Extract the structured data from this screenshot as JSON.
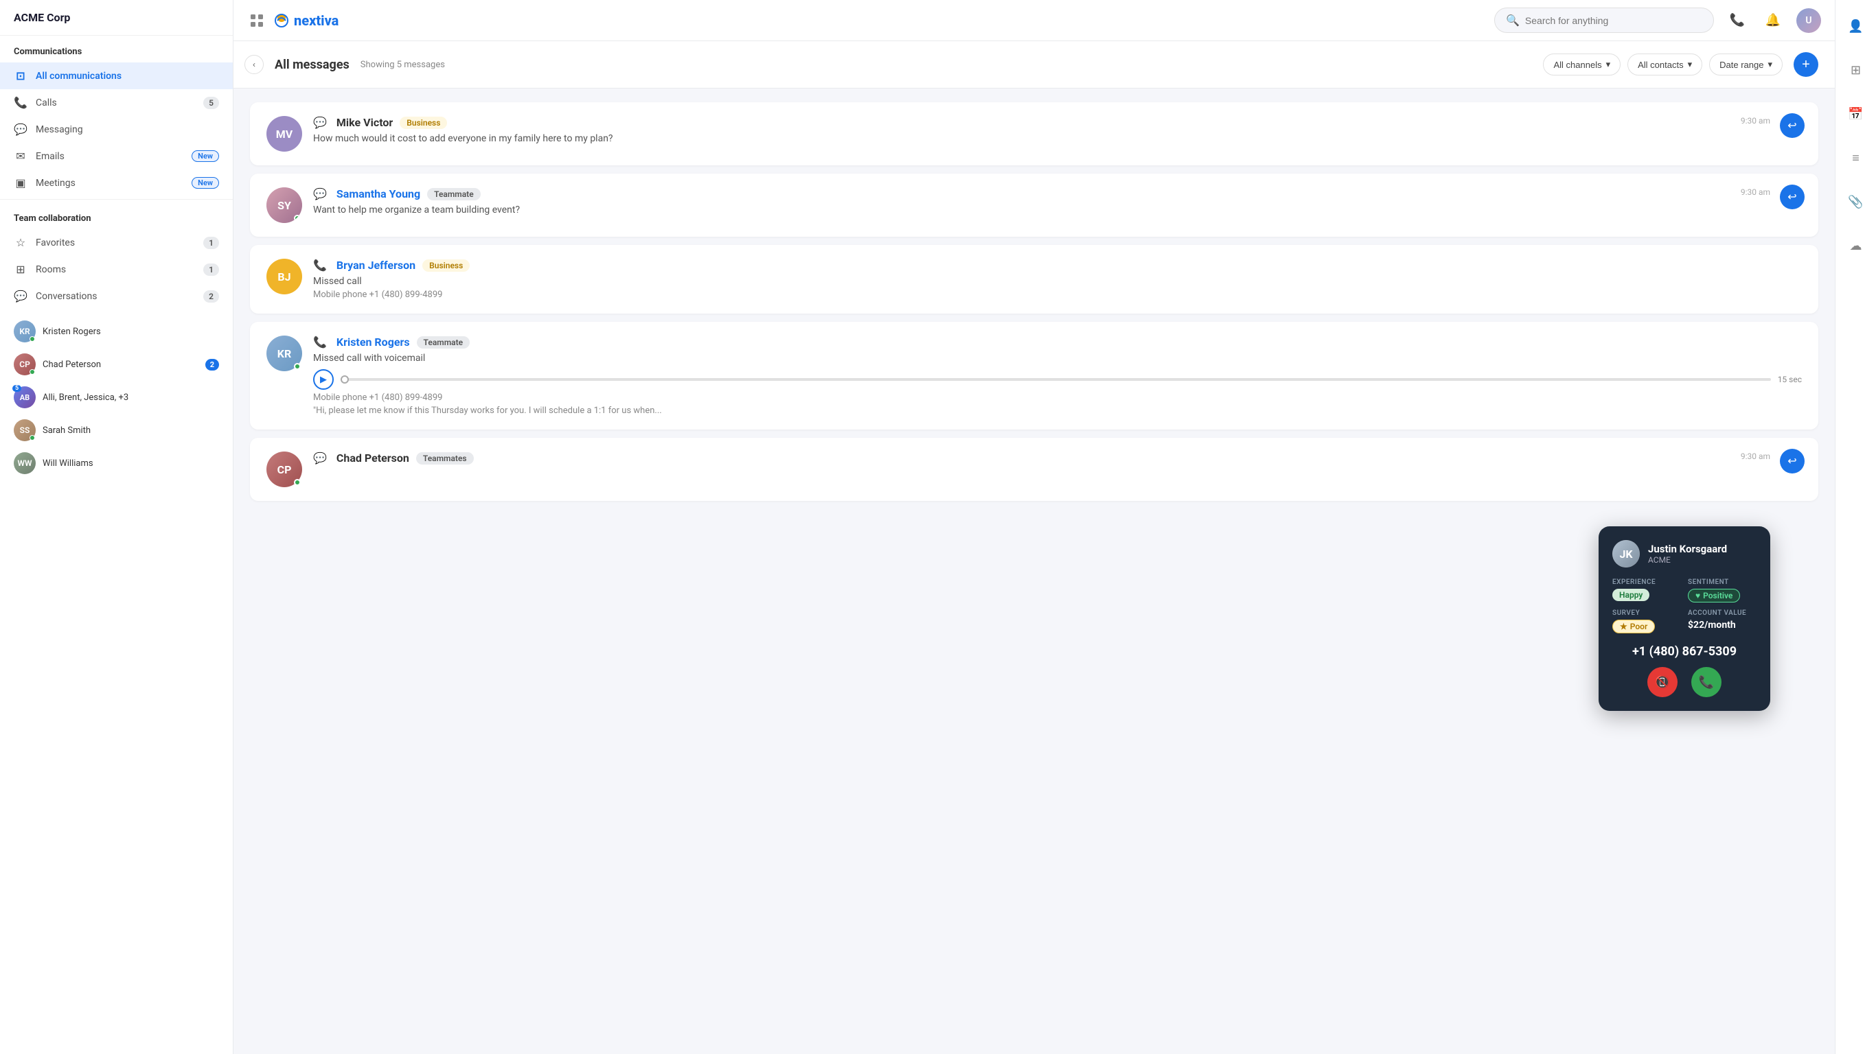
{
  "app": {
    "logo_text": "nextiva",
    "company": "ACME Corp"
  },
  "topnav": {
    "search_placeholder": "Search for anything"
  },
  "sidebar": {
    "header": "ACME Corp",
    "communications_section": "Communications",
    "nav_items": [
      {
        "id": "all-communications",
        "label": "All communications",
        "icon": "⊡",
        "badge": null,
        "active": true
      },
      {
        "id": "calls",
        "label": "Calls",
        "icon": "📞",
        "badge": "5",
        "active": false
      },
      {
        "id": "messaging",
        "label": "Messaging",
        "icon": "💬",
        "badge": null,
        "active": false
      },
      {
        "id": "emails",
        "label": "Emails",
        "icon": "✉️",
        "badge_new": "New",
        "active": false
      },
      {
        "id": "meetings",
        "label": "Meetings",
        "icon": "⬛",
        "badge_new": "New",
        "active": false
      }
    ],
    "team_collaboration": "Team collaboration",
    "team_items": [
      {
        "id": "favorites",
        "label": "Favorites",
        "icon": "☆",
        "badge": "1"
      },
      {
        "id": "rooms",
        "label": "Rooms",
        "icon": "⊞",
        "badge": "1"
      },
      {
        "id": "conversations",
        "label": "Conversations",
        "icon": "💬",
        "badge": "2"
      }
    ],
    "conversations_list": [
      {
        "id": "kristen-rogers",
        "name": "Kristen Rogers",
        "avatar_bg": "#a8c4e0",
        "initials": "KR",
        "online": true,
        "conv_badge": null,
        "img": true
      },
      {
        "id": "chad-peterson",
        "name": "Chad Peterson",
        "avatar_bg": "#c4a0a0",
        "initials": "CP",
        "online": true,
        "conv_badge": "2",
        "img": true
      },
      {
        "id": "alli-brent-jessica",
        "name": "Alli, Brent, Jessica, +3",
        "avatar_bg": "#aab4e0",
        "initials": "AB",
        "online": false,
        "conv_badge": null,
        "group_num": "5"
      },
      {
        "id": "sarah-smith",
        "name": "Sarah Smith",
        "avatar_bg": "#c4b0a0",
        "initials": "SS",
        "online": true,
        "conv_badge": null,
        "img": true
      },
      {
        "id": "will-williams",
        "name": "Will Williams",
        "avatar_bg": "#b0c4b0",
        "initials": "WW",
        "online": false,
        "conv_badge": null
      }
    ]
  },
  "content": {
    "title": "All messages",
    "subtitle": "Showing 5 messages",
    "filters": {
      "channels": "All channels",
      "contacts": "All contacts",
      "date_range": "Date range"
    },
    "messages": [
      {
        "id": "mike-victor",
        "name": "Mike Victor",
        "initials": "MV",
        "avatar_bg": "#9b8cc4",
        "badge": "Business",
        "badge_type": "business",
        "icon_type": "chat",
        "text": "How much would it cost to add everyone in my family here to my plan?",
        "time": "9:30 am",
        "has_reply": true,
        "type": "chat"
      },
      {
        "id": "samantha-young",
        "name": "Samantha Young",
        "initials": "SY",
        "avatar_bg": null,
        "badge": "Teammate",
        "badge_type": "teammate",
        "icon_type": "chat",
        "text": "Want to help me organize a team building event?",
        "time": "9:30 am",
        "has_reply": true,
        "type": "chat",
        "img": true
      },
      {
        "id": "bryan-jefferson",
        "name": "Bryan Jefferson",
        "initials": "BJ",
        "avatar_bg": "#f0b429",
        "badge": "Business",
        "badge_type": "business",
        "icon_type": "phone",
        "text": "Missed call",
        "sub_text": "Mobile phone +1 (480) 899-4899",
        "time": null,
        "has_reply": false,
        "type": "call"
      },
      {
        "id": "kristen-rogers",
        "name": "Kristen Rogers",
        "initials": "KR",
        "avatar_bg": null,
        "badge": "Teammate",
        "badge_type": "teammate",
        "icon_type": "phone",
        "text": "Missed call with voicemail",
        "sub_text": "Mobile phone +1 (480) 899-4899",
        "voicemail_text": "\"Hi, please let me know if this Thursday works for you. I will schedule a 1:1 for us when...",
        "duration": "15 sec",
        "time": null,
        "has_reply": false,
        "type": "voicemail",
        "img": true,
        "online": true
      },
      {
        "id": "chad-peterson",
        "name": "Chad Peterson",
        "initials": "CP",
        "avatar_bg": null,
        "badge": "Teammates",
        "badge_type": "teammates",
        "icon_type": "chat",
        "text": "",
        "time": "9:30 am",
        "has_reply": true,
        "type": "chat",
        "img": true
      }
    ]
  },
  "contact_card": {
    "name": "Justin Korsgaard",
    "company": "ACME",
    "experience_label": "EXPERIENCE",
    "sentiment_label": "SENTIMENT",
    "survey_label": "SURVEY",
    "account_value_label": "ACCOUNT VALUE",
    "experience_value": "Happy",
    "sentiment_value": "Positive",
    "survey_value": "Poor",
    "account_value": "$22/month",
    "phone": "+1 (480) 867-5309"
  },
  "right_icons": {
    "icons": [
      "👤",
      "⊞",
      "📅",
      "≡",
      "📎",
      "☁"
    ]
  }
}
